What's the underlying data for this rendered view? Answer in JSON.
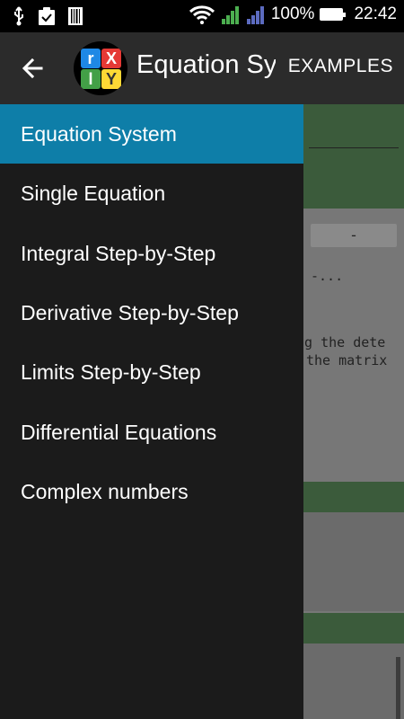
{
  "status_bar": {
    "battery": "100%",
    "time": "22:42",
    "icons": [
      "usb-icon",
      "clipboard-check-icon",
      "barcode-icon",
      "wifi-icon",
      "signal-green-icon",
      "signal-blue-icon",
      "battery-icon"
    ]
  },
  "app_bar": {
    "title": "Equation System",
    "action": "EXAMPLES",
    "back_icon": "back-arrow-icon",
    "logo_letters": [
      "r",
      "X",
      "l",
      "Y"
    ]
  },
  "drawer": {
    "items": [
      {
        "label": "Equation System",
        "active": true
      },
      {
        "label": "Single Equation",
        "active": false
      },
      {
        "label": "Integral Step-by-Step",
        "active": false
      },
      {
        "label": "Derivative Step-by-Step",
        "active": false
      },
      {
        "label": "Limits Step-by-Step",
        "active": false
      },
      {
        "label": "Differential Equations",
        "active": false
      },
      {
        "label": "Complex numbers",
        "active": false
      }
    ]
  },
  "background": {
    "minus_button": "-",
    "dots": "-...",
    "text_line1": "ng the dete",
    "text_line2": "the matrix"
  },
  "colors": {
    "accent": "#0e7ea8",
    "drawer_bg": "#1b1b1b",
    "appbar_bg": "#2b2b2b",
    "logo_blue": "#1e88e5",
    "logo_red": "#e53935",
    "logo_green": "#43a047",
    "logo_yellow": "#fdd835"
  }
}
